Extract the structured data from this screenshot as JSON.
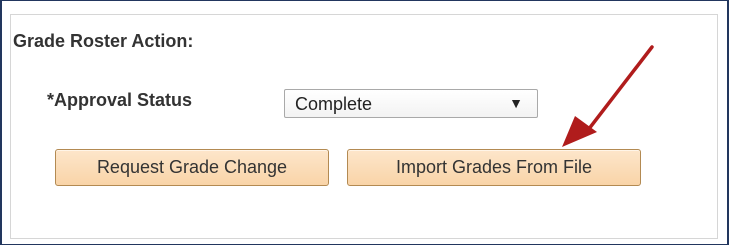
{
  "grade_roster": {
    "section_title": "Grade Roster Action:",
    "approval_status": {
      "label": "*Approval Status",
      "selected_value": "Complete",
      "dropdown_glyph": "▼"
    },
    "buttons": {
      "request_grade_change": "Request Grade Change",
      "import_grades": "Import Grades From File"
    }
  },
  "annotation": {
    "arrow_color": "#b01c1c",
    "icon": "red-arrow-pointing-to-import-button"
  },
  "colors": {
    "button_fill": "#f9d4a8",
    "button_border": "#b38a52",
    "frame_border": "#22365e"
  }
}
